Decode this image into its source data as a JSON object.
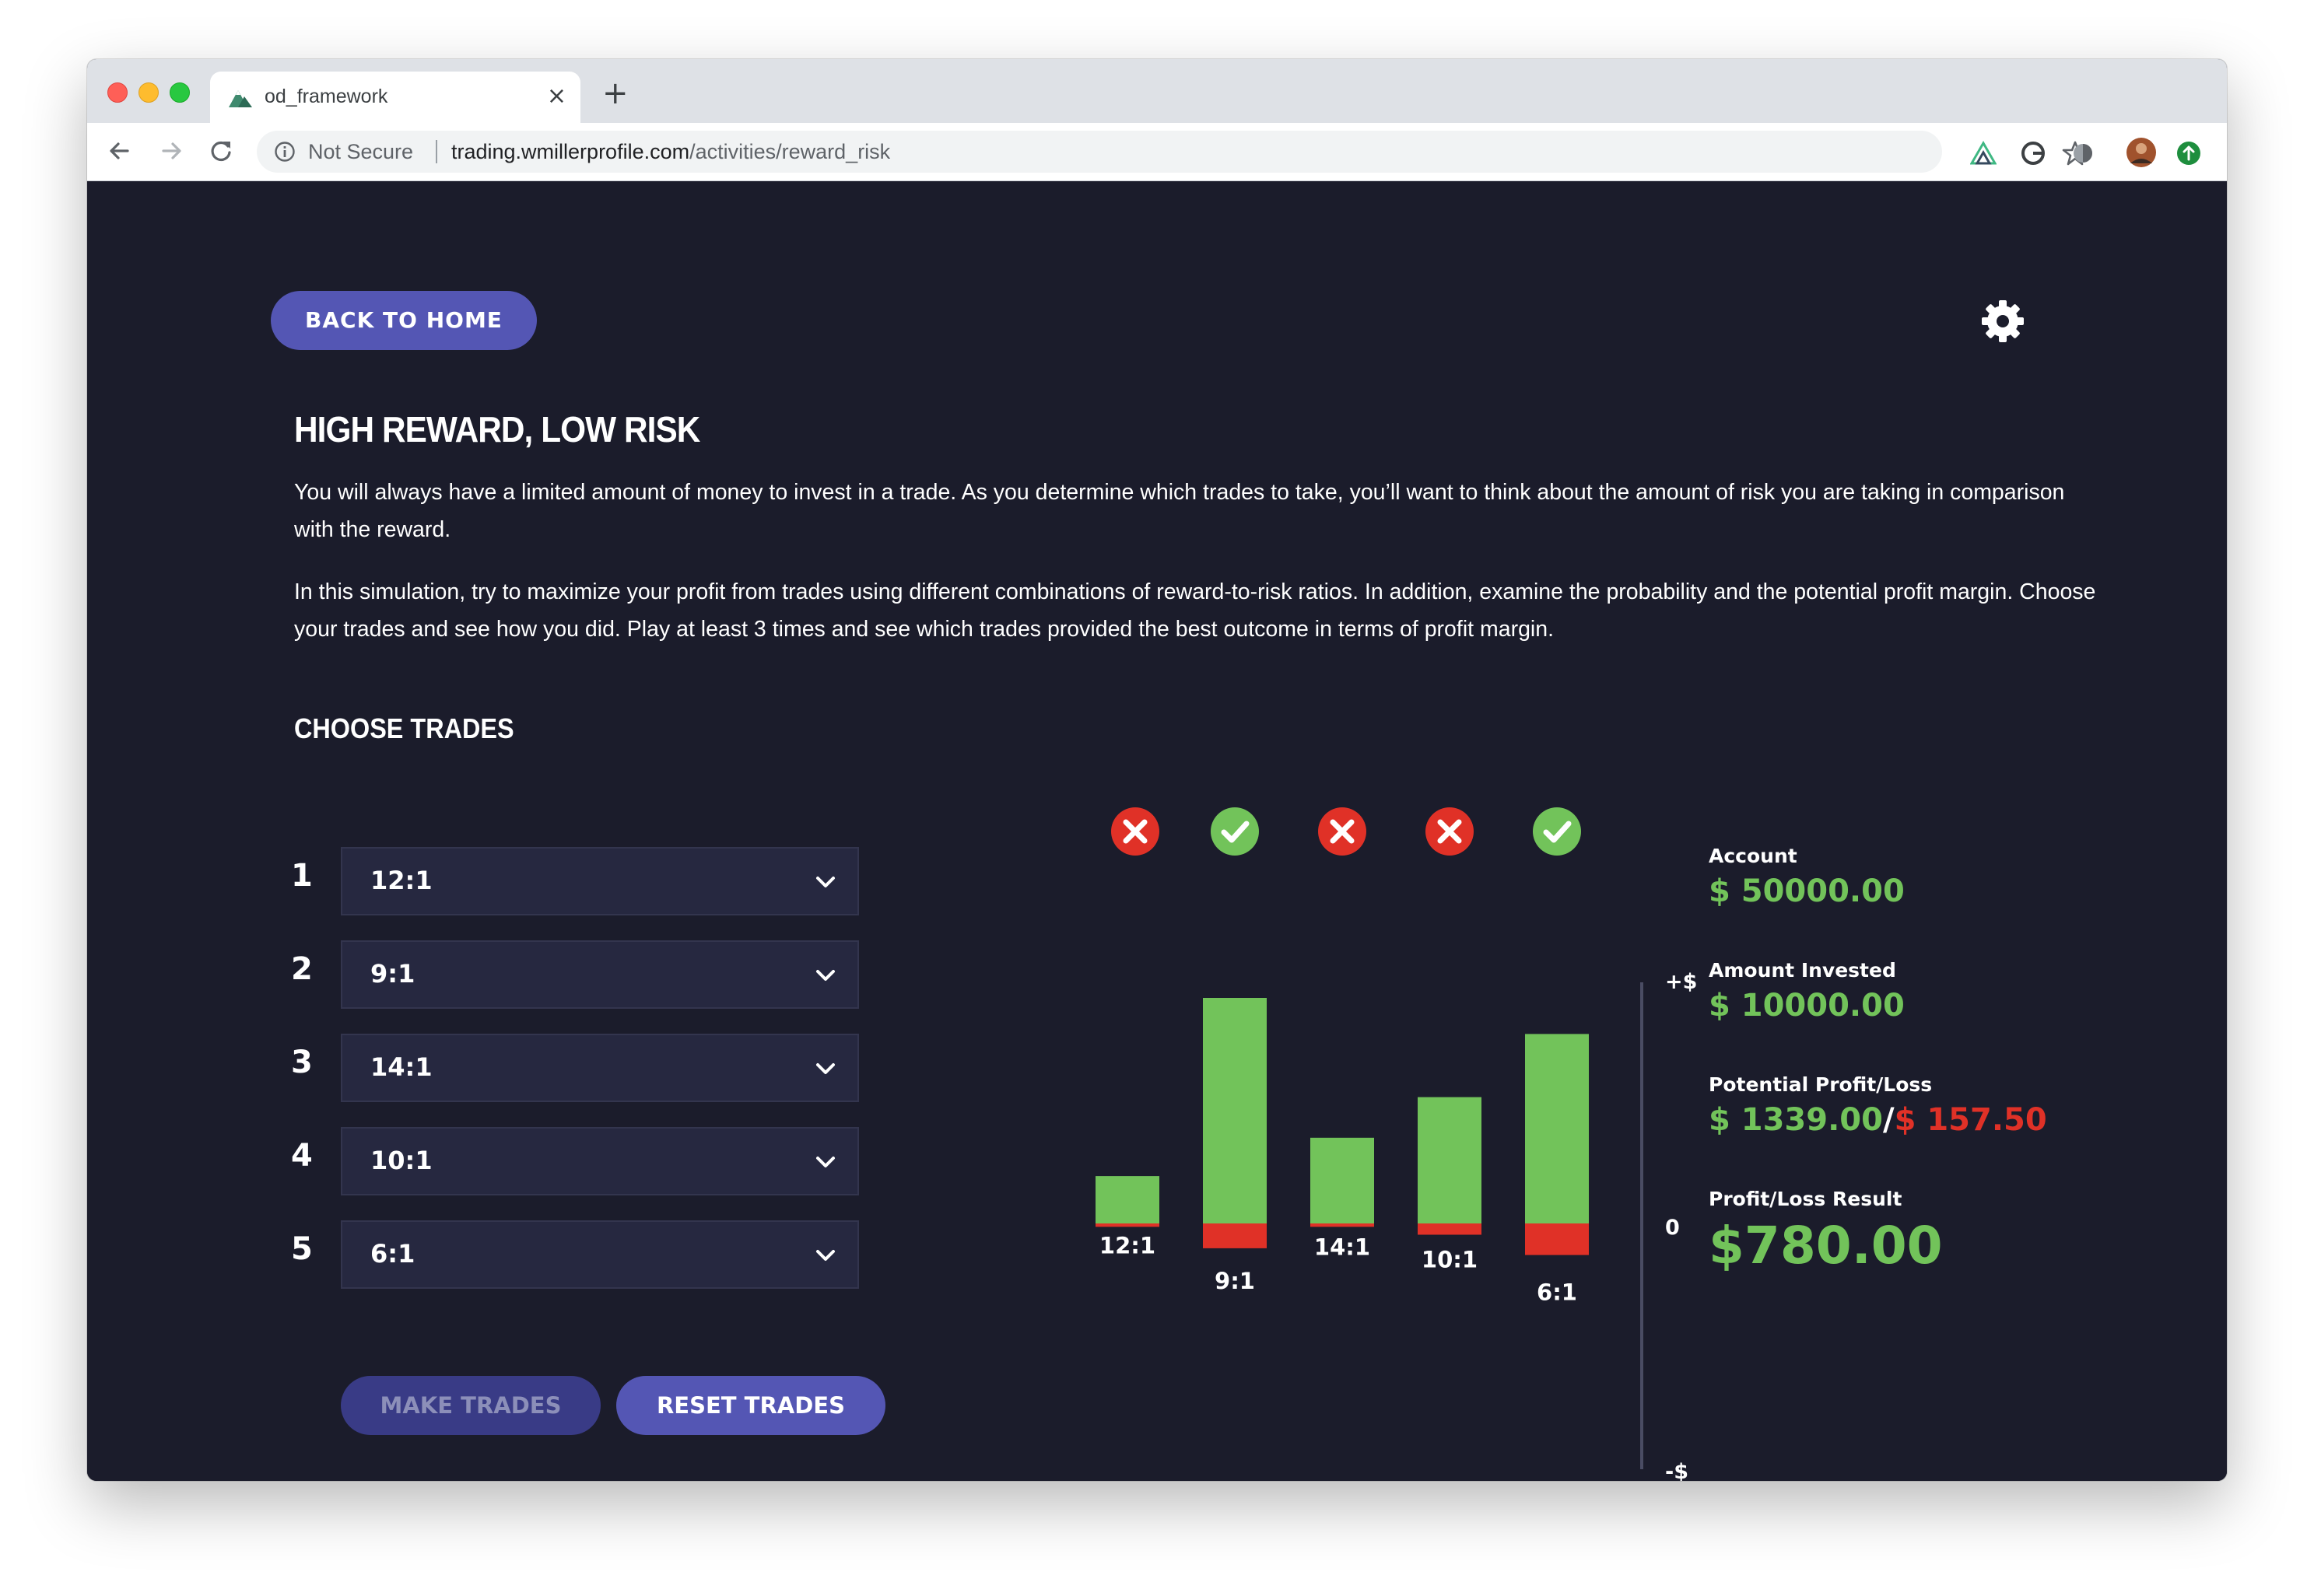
{
  "browser": {
    "tab_title": "od_framework",
    "tab_close": "×",
    "new_tab": "+",
    "security_label": "Not Secure",
    "url_host": "trading.wmillerprofile.com",
    "url_path": "/activities/reward_risk"
  },
  "page": {
    "back_label": "BACK TO HOME",
    "title": "HIGH REWARD, LOW RISK",
    "intro_1": "You will always have a limited amount of money to invest in a trade. As you determine which trades to take, you’ll want to think about the amount of risk you are taking in comparison with the reward.",
    "intro_2": "In this simulation, try to maximize your profit from trades using different combinations of reward-to-risk ratios. In addition, examine the probability and the potential profit margin. Choose your trades and see how you did. Play at least 3 times and see which trades provided the best outcome in terms of profit margin."
  },
  "trades": {
    "heading": "CHOOSE TRADES",
    "items": [
      {
        "num": "1",
        "value": "12:1"
      },
      {
        "num": "2",
        "value": "9:1"
      },
      {
        "num": "3",
        "value": "14:1"
      },
      {
        "num": "4",
        "value": "10:1"
      },
      {
        "num": "5",
        "value": "6:1"
      }
    ],
    "make_label": "MAKE TRADES",
    "reset_label": "RESET TRADES"
  },
  "chart_data": {
    "type": "bar",
    "categories": [
      "12:1",
      "9:1",
      "14:1",
      "10:1",
      "6:1"
    ],
    "series": [
      {
        "values": [
          0.21,
          1.0,
          0.38,
          0.56,
          0.84
        ]
      },
      {
        "values": [
          -0.015,
          -0.11,
          -0.015,
          -0.05,
          -0.14
        ]
      }
    ],
    "outcomes": [
      "loss",
      "win",
      "loss",
      "loss",
      "win"
    ],
    "y_ticks": [
      "+$",
      "0",
      "-$"
    ],
    "colors": {
      "reward": "#72c35a",
      "risk": "#e03127",
      "win": "#72c35a",
      "loss": "#e03127"
    }
  },
  "stats": {
    "account_label": "Account",
    "account_value": "$ 50000.00",
    "invested_label": "Amount Invested",
    "invested_value": "$ 10000.00",
    "potential_label": "Potential Profit/Loss",
    "potential_profit": "$ 1339.00",
    "potential_sep": "/",
    "potential_loss": "$ 157.50",
    "result_label": "Profit/Loss Result",
    "result_value": "$780.00"
  }
}
